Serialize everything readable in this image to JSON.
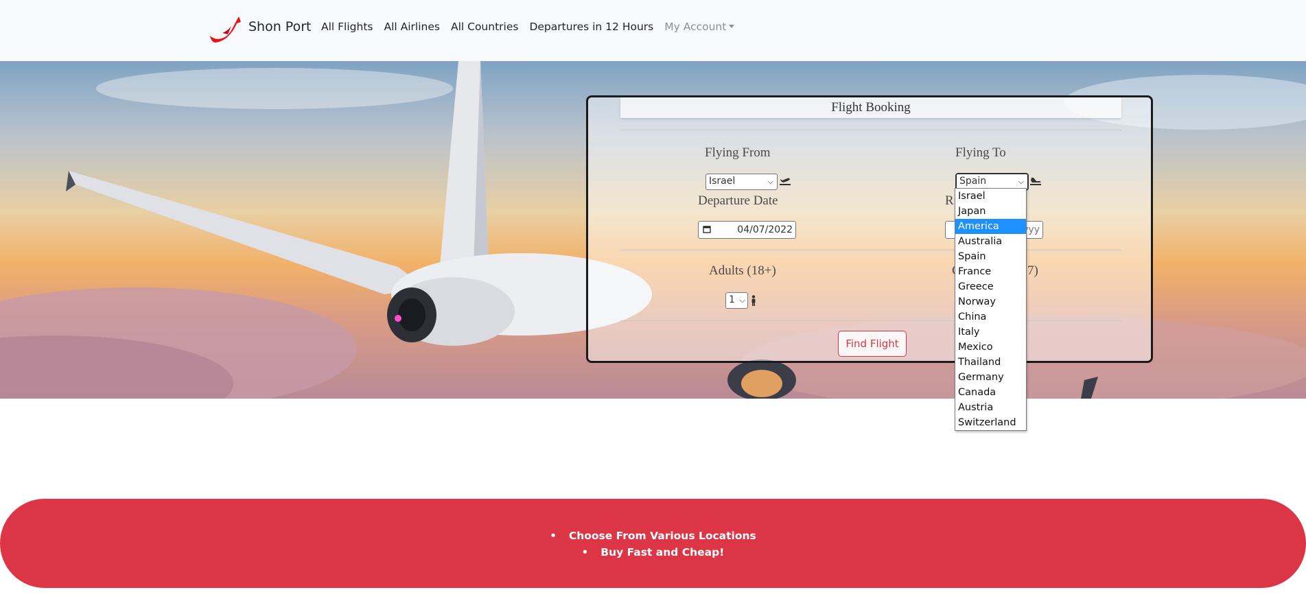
{
  "brand": {
    "name": "Shon Port"
  },
  "nav": {
    "items": [
      "All Flights",
      "All Airlines",
      "All Countries",
      "Departures in 12 Hours"
    ],
    "account": "My Account"
  },
  "booking": {
    "title": "Flight Booking",
    "flying_from_label": "Flying From",
    "flying_from_value": "Israel",
    "flying_to_label": "Flying To",
    "flying_to_value": "Spain",
    "departure_label": "Departure Date",
    "departure_value": "04/07/2022",
    "return_label_visible": "R",
    "return_value_visible": "yyy",
    "adults_label": "Adults (18+)",
    "adults_value": "1",
    "children_label_visible": "C",
    "children_label_tail": "7)",
    "find_button": "Find Flight"
  },
  "dropdown": {
    "options": [
      "Israel",
      "Japan",
      "America",
      "Australia",
      "Spain",
      "France",
      "Greece",
      "Norway",
      "China",
      "Italy",
      "Mexico",
      "Thailand",
      "Germany",
      "Canada",
      "Austria",
      "Switzerland"
    ],
    "highlighted": "America"
  },
  "banner": {
    "bullets": [
      "Choose From Various Locations",
      "Buy Fast and Cheap!"
    ]
  },
  "colors": {
    "accent_red": "#dc3545",
    "navbar_bg": "#f8f9fa",
    "highlight_blue": "#1e90ff"
  }
}
